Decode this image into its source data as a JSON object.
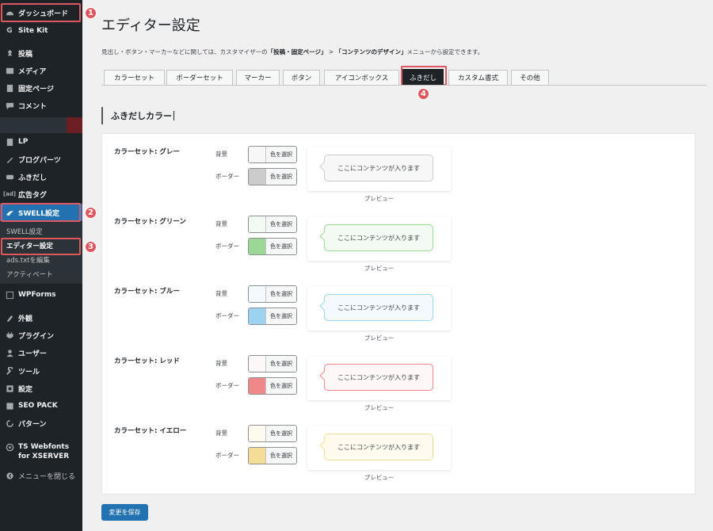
{
  "sidebar": {
    "items": [
      {
        "label": "ダッシュボード",
        "icon": "dashboard-icon"
      },
      {
        "label": "Site Kit",
        "icon": "sitekit-icon"
      },
      {
        "label": "投稿",
        "icon": "pin-icon"
      },
      {
        "label": "メディア",
        "icon": "media-icon"
      },
      {
        "label": "固定ページ",
        "icon": "page-icon"
      },
      {
        "label": "コメント",
        "icon": "comment-icon"
      },
      {
        "label": "LP",
        "icon": "lp-icon"
      },
      {
        "label": "ブログパーツ",
        "icon": "blogparts-icon"
      },
      {
        "label": "ふきだし",
        "icon": "balloon-icon"
      },
      {
        "label": "広告タグ",
        "icon": "ad-icon"
      },
      {
        "label": "SWELL設定",
        "icon": "swell-icon"
      },
      {
        "label": "WPForms",
        "icon": "wpforms-icon"
      },
      {
        "label": "外観",
        "icon": "appearance-icon"
      },
      {
        "label": "プラグイン",
        "icon": "plugin-icon"
      },
      {
        "label": "ユーザー",
        "icon": "user-icon"
      },
      {
        "label": "ツール",
        "icon": "tool-icon"
      },
      {
        "label": "設定",
        "icon": "settings-icon"
      },
      {
        "label": "SEO PACK",
        "icon": "seo-icon"
      },
      {
        "label": "パターン",
        "icon": "pattern-icon"
      },
      {
        "label": "TS Webfonts for XSERVER",
        "icon": "webfonts-icon"
      },
      {
        "label": "メニューを閉じる",
        "icon": "collapse-icon"
      }
    ],
    "submenu": [
      "SWELL設定",
      "エディター設定",
      "ads.txtを編集",
      "アクティベート"
    ],
    "badges": [
      "1",
      "2",
      "3",
      "4"
    ]
  },
  "page": {
    "title": "エディター設定",
    "desc_prefix": "見出し・ボタン・マーカーなどに関しては、カスタマイザーの",
    "desc_bold1": "「投稿・固定ページ」",
    "desc_sep": " > ",
    "desc_bold2": "「コンテンツのデザイン」",
    "desc_suffix": "メニューから設定できます。"
  },
  "tabs": [
    "カラーセット",
    "ボーダーセット",
    "マーカー",
    "ボタン",
    "アイコンボックス",
    "ふきだし",
    "カスタム書式",
    "その他"
  ],
  "active_tab": "ふきだし",
  "section": {
    "heading": "ふきだしカラー"
  },
  "fields": {
    "bg_label": "背景",
    "border_label": "ボーダー",
    "button_label": "色を選択"
  },
  "preview": {
    "text": "ここにコンテンツが入ります",
    "caption": "プレビュー"
  },
  "color_sets": [
    {
      "name": "カラーセット: グレー",
      "bg": "#f7f7f7",
      "border": "#cccccc"
    },
    {
      "name": "カラーセット: グリーン",
      "bg": "#f3faf3",
      "border": "#9bd795"
    },
    {
      "name": "カラーセット: ブルー",
      "bg": "#f3f9fc",
      "border": "#9dd3f1"
    },
    {
      "name": "カラーセット: レッド",
      "bg": "#fef7f7",
      "border": "#f0888a"
    },
    {
      "name": "カラーセット: イエロー",
      "bg": "#fefbee",
      "border": "#f5dd97"
    }
  ],
  "save_button": "変更を保存",
  "colors": {
    "accent": "#2271b1",
    "highlight": "#e0565f",
    "sidebar": "#1d2327"
  }
}
